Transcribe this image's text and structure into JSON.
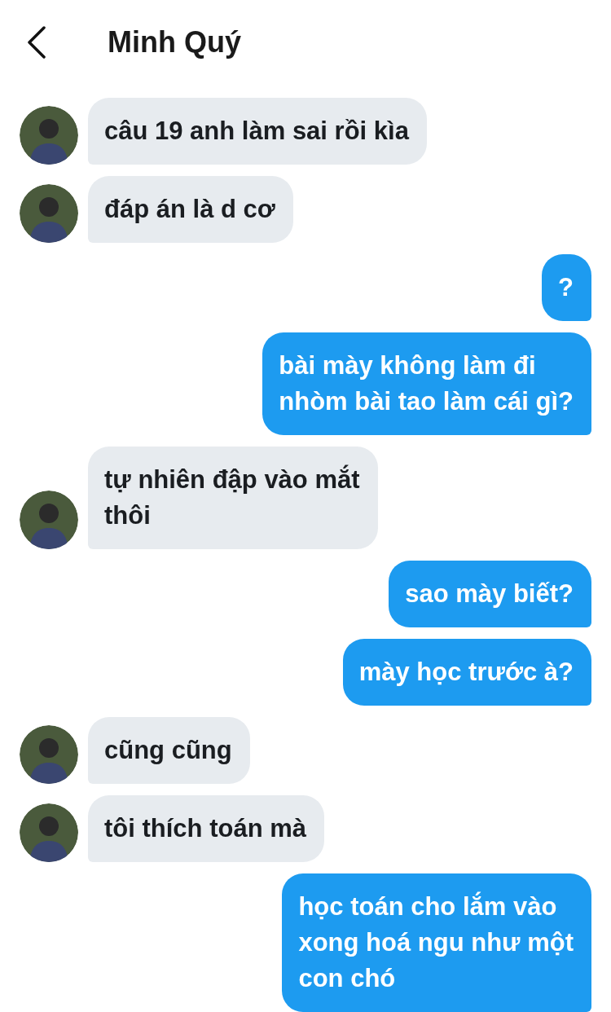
{
  "header": {
    "title": "Minh Quý"
  },
  "messages": [
    {
      "kind": "incoming",
      "lines": [
        "câu 19 anh làm sai rồi kìa"
      ]
    },
    {
      "kind": "incoming",
      "lines": [
        "đáp án là d cơ"
      ]
    },
    {
      "kind": "outgoing",
      "lines": [
        "?"
      ]
    },
    {
      "kind": "outgoing",
      "lines": [
        "bài mày không làm đi",
        "nhòm bài tao làm cái gì?"
      ]
    },
    {
      "kind": "incoming",
      "lines": [
        "tự nhiên đập vào mắt",
        "thôi"
      ]
    },
    {
      "kind": "outgoing",
      "lines": [
        "sao mày biết?"
      ]
    },
    {
      "kind": "outgoing",
      "lines": [
        "mày học trước à?"
      ]
    },
    {
      "kind": "incoming",
      "lines": [
        "cũng cũng"
      ]
    },
    {
      "kind": "incoming",
      "lines": [
        "tôi thích toán mà"
      ]
    },
    {
      "kind": "outgoing",
      "lines": [
        "học toán cho lắm vào",
        "xong hoá ngu như một",
        "con chó"
      ]
    }
  ]
}
